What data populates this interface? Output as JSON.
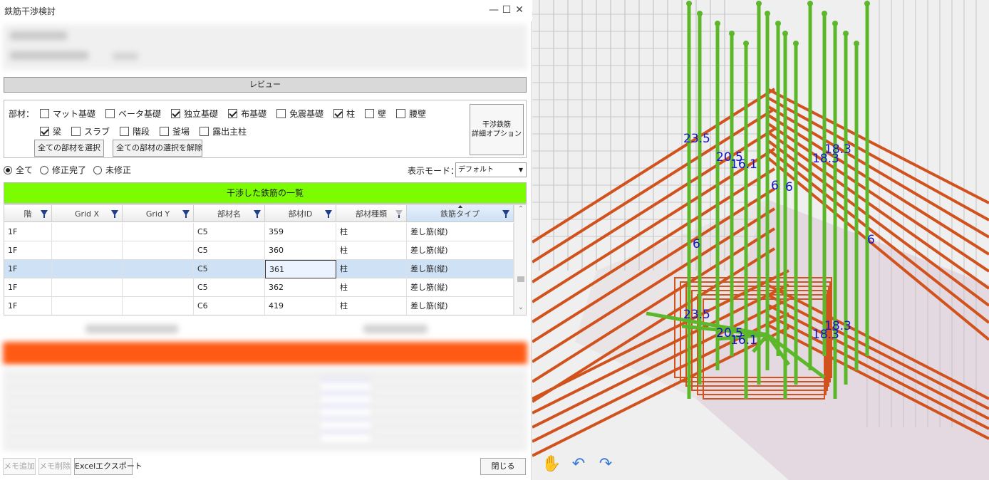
{
  "window": {
    "title": "鉄筋干渉検討",
    "minimize": "—",
    "maximize": "☐",
    "close": "✕"
  },
  "review_button": "レビュー",
  "filter": {
    "label": "部材：",
    "row1": [
      {
        "label": "マット基礎",
        "checked": false
      },
      {
        "label": "ベータ基礎",
        "checked": false
      },
      {
        "label": "独立基礎",
        "checked": true
      },
      {
        "label": "布基礎",
        "checked": true
      },
      {
        "label": "免震基礎",
        "checked": false
      },
      {
        "label": "柱",
        "checked": true
      },
      {
        "label": "壁",
        "checked": false
      },
      {
        "label": "腰壁",
        "checked": false
      }
    ],
    "row2": [
      {
        "label": "梁",
        "checked": true
      },
      {
        "label": "スラブ",
        "checked": false
      },
      {
        "label": "階段",
        "checked": false
      },
      {
        "label": "釜場",
        "checked": false
      },
      {
        "label": "露出主柱",
        "checked": false
      }
    ],
    "select_all": "全ての部材を選択",
    "deselect_all": "全ての部材の選択を解除",
    "option_line1": "干渉鉄筋",
    "option_line2": "詳細オプション"
  },
  "status_filter": {
    "options": [
      {
        "label": "全て",
        "selected": true
      },
      {
        "label": "修正完了",
        "selected": false
      },
      {
        "label": "未修正",
        "selected": false
      }
    ]
  },
  "display_mode": {
    "label": "表示モード：",
    "value": "デフォルト"
  },
  "grid": {
    "title": "干渉した鉄筋の一覧",
    "columns": [
      "階",
      "Grid X",
      "Grid Y",
      "部材名",
      "部材ID",
      "部材種類",
      "鉄筋タイプ"
    ],
    "rows": [
      [
        "1F",
        "",
        "",
        "C5",
        "359",
        "柱",
        "差し筋(縦)"
      ],
      [
        "1F",
        "",
        "",
        "C5",
        "360",
        "柱",
        "差し筋(縦)"
      ],
      [
        "1F",
        "",
        "",
        "C5",
        "361",
        "柱",
        "差し筋(縦)"
      ],
      [
        "1F",
        "",
        "",
        "C5",
        "362",
        "柱",
        "差し筋(縦)"
      ],
      [
        "1F",
        "",
        "",
        "C6",
        "419",
        "柱",
        "差し筋(縦)"
      ]
    ],
    "selected_row": 2
  },
  "footer": {
    "memo_add": "メモ追加",
    "memo_delete": "メモ削除",
    "excel_export": "Excelエクスポート",
    "close": "閉じる"
  },
  "view3d": {
    "dimension_labels": [
      "23.5",
      "20.5",
      "16.1",
      "18.3",
      "18.3",
      "6",
      "6",
      "6",
      "6",
      "23.5",
      "20.5",
      "16.1",
      "18.3",
      "18.3"
    ],
    "rebar_vertical_color": "#5cb82a",
    "rebar_horizontal_color": "#d2521e",
    "nav_icons": [
      "hand-pan-icon",
      "undo-arrow-icon",
      "redo-arrow-icon"
    ]
  },
  "colors": {
    "grid_header": "#7cfc00",
    "selected_row": "#cfe1f5",
    "blurred_header": "#ff5a14",
    "dimension_text": "#1414c8"
  }
}
